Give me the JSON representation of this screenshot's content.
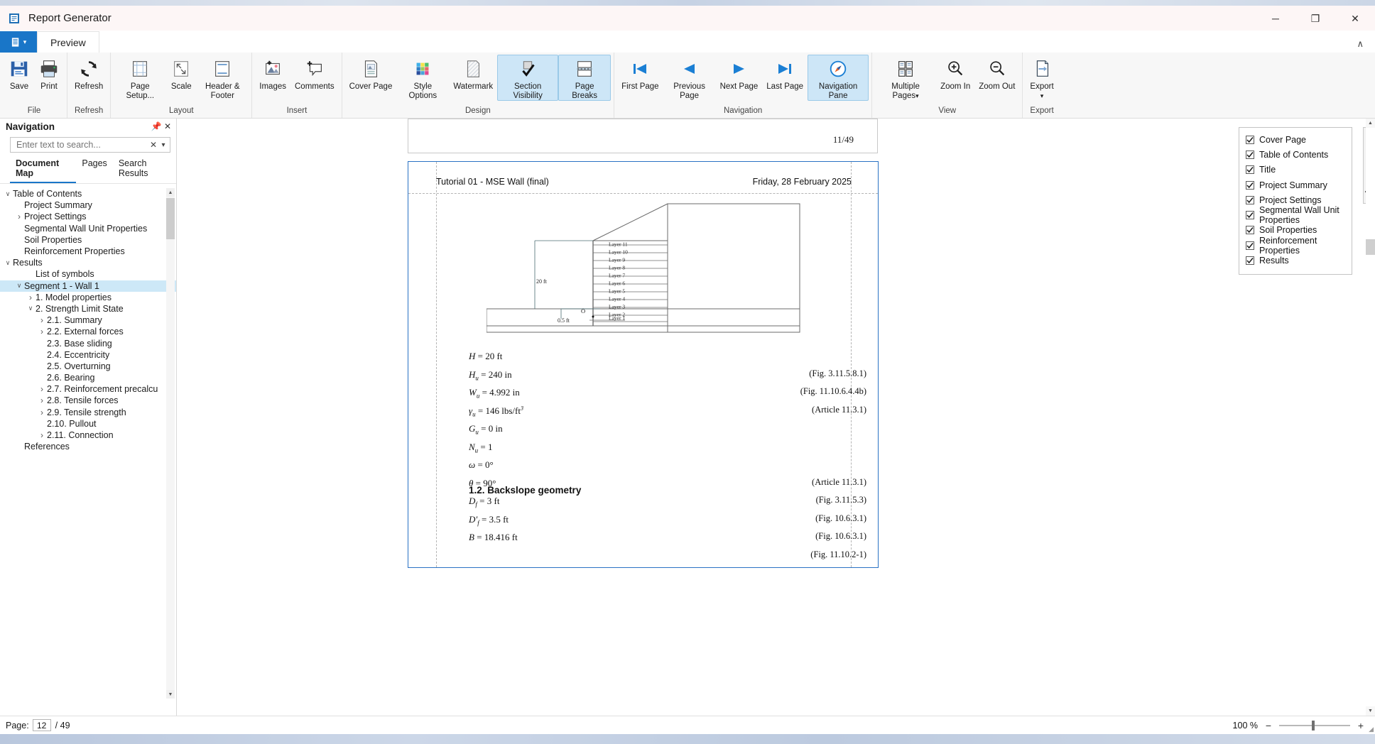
{
  "window": {
    "title": "Report Generator",
    "app_icon": "report-app-icon",
    "minimize": "─",
    "maximize": "❐",
    "close": "✕",
    "collapse_ribbon": "∧"
  },
  "ribbon": {
    "app_menu_label": "menu-icon",
    "tabs": [
      {
        "label": "Preview",
        "active": true
      }
    ],
    "groups": [
      {
        "name": "File",
        "label": "File",
        "items": [
          {
            "label": "Save",
            "icon": "save-icon",
            "selected": false
          },
          {
            "label": "Print",
            "icon": "print-icon",
            "selected": false
          }
        ]
      },
      {
        "name": "Refresh",
        "label": "Refresh",
        "items": [
          {
            "label": "Refresh",
            "icon": "refresh-icon",
            "selected": false
          }
        ]
      },
      {
        "name": "Layout",
        "label": "Layout",
        "items": [
          {
            "label": "Page Setup...",
            "icon": "page-setup-icon",
            "selected": false
          },
          {
            "label": "Scale",
            "icon": "scale-icon",
            "selected": false
          },
          {
            "label": "Header & Footer",
            "icon": "header-footer-icon",
            "selected": false
          }
        ]
      },
      {
        "name": "Insert",
        "label": "Insert",
        "items": [
          {
            "label": "Images",
            "icon": "images-icon",
            "selected": false
          },
          {
            "label": "Comments",
            "icon": "comments-icon",
            "selected": false
          }
        ]
      },
      {
        "name": "Design",
        "label": "Design",
        "items": [
          {
            "label": "Cover Page",
            "icon": "cover-page-icon",
            "selected": false
          },
          {
            "label": "Style Options",
            "icon": "style-options-icon",
            "selected": false
          },
          {
            "label": "Watermark",
            "icon": "watermark-icon",
            "selected": false
          },
          {
            "label": "Section Visibility",
            "icon": "section-visibility-icon",
            "selected": true
          },
          {
            "label": "Page Breaks",
            "icon": "page-breaks-icon",
            "selected": true
          }
        ]
      },
      {
        "name": "Navigation",
        "label": "Navigation",
        "items": [
          {
            "label": "First Page",
            "icon": "first-page-icon",
            "selected": false
          },
          {
            "label": "Previous Page",
            "icon": "previous-page-icon",
            "selected": false
          },
          {
            "label": "Next Page",
            "icon": "next-page-icon",
            "selected": false
          },
          {
            "label": "Last Page",
            "icon": "last-page-icon",
            "selected": false
          },
          {
            "label": "Navigation Pane",
            "icon": "navigation-pane-icon",
            "selected": true
          }
        ]
      },
      {
        "name": "View",
        "label": "View",
        "items": [
          {
            "label": "Multiple Pages",
            "icon": "multiple-pages-icon",
            "selected": false,
            "dropdown": true
          },
          {
            "label": "Zoom In",
            "icon": "zoom-in-icon",
            "selected": false
          },
          {
            "label": "Zoom Out",
            "icon": "zoom-out-icon",
            "selected": false
          }
        ]
      },
      {
        "name": "Export",
        "label": "Export",
        "items": [
          {
            "label": "Export",
            "icon": "export-icon",
            "selected": false,
            "dropdown": true
          }
        ]
      }
    ]
  },
  "navigation": {
    "title": "Navigation",
    "pin_icon": "pin-icon",
    "close_icon": "close-icon",
    "search": {
      "placeholder": "Enter text to search...",
      "value": "",
      "clear_icon": "clear-icon",
      "dropdown_icon": "chevron-down-icon"
    },
    "tabs": [
      {
        "label": "Document Map",
        "active": true
      },
      {
        "label": "Pages",
        "active": false
      },
      {
        "label": "Search Results",
        "active": false
      }
    ],
    "tree": [
      {
        "label": "Table of Contents",
        "indent": 1,
        "twisty": "down",
        "selected": false
      },
      {
        "label": "Project Summary",
        "indent": 2,
        "twisty": "none",
        "selected": false
      },
      {
        "label": "Project Settings",
        "indent": 2,
        "twisty": "right",
        "selected": false
      },
      {
        "label": "Segmental Wall Unit Properties",
        "indent": 2,
        "twisty": "none",
        "selected": false
      },
      {
        "label": "Soil Properties",
        "indent": 2,
        "twisty": "none",
        "selected": false
      },
      {
        "label": "Reinforcement Properties",
        "indent": 2,
        "twisty": "none",
        "selected": false
      },
      {
        "label": "Results",
        "indent": 1,
        "twisty": "down",
        "selected": false
      },
      {
        "label": "List of symbols",
        "indent": 3,
        "twisty": "none",
        "selected": false
      },
      {
        "label": "Segment 1 - Wall 1",
        "indent": 2,
        "twisty": "down",
        "selected": true
      },
      {
        "label": "1.  Model properties",
        "indent": 3,
        "twisty": "right",
        "selected": false
      },
      {
        "label": "2.  Strength Limit State",
        "indent": 3,
        "twisty": "down",
        "selected": false
      },
      {
        "label": "2.1.  Summary",
        "indent": 4,
        "twisty": "right",
        "selected": false
      },
      {
        "label": "2.2.  External forces",
        "indent": 4,
        "twisty": "right",
        "selected": false
      },
      {
        "label": "2.3.  Base sliding",
        "indent": 4,
        "twisty": "none",
        "selected": false
      },
      {
        "label": "2.4.  Eccentricity",
        "indent": 4,
        "twisty": "none",
        "selected": false
      },
      {
        "label": "2.5.  Overturning",
        "indent": 4,
        "twisty": "none",
        "selected": false
      },
      {
        "label": "2.6.  Bearing",
        "indent": 4,
        "twisty": "none",
        "selected": false
      },
      {
        "label": "2.7.  Reinforcement precalcu",
        "indent": 4,
        "twisty": "right",
        "selected": false
      },
      {
        "label": "2.8.  Tensile forces",
        "indent": 4,
        "twisty": "right",
        "selected": false
      },
      {
        "label": "2.9.  Tensile strength",
        "indent": 4,
        "twisty": "right",
        "selected": false
      },
      {
        "label": "2.10.  Pullout",
        "indent": 4,
        "twisty": "none",
        "selected": false
      },
      {
        "label": "2.11.  Connection",
        "indent": 4,
        "twisty": "right",
        "selected": false
      },
      {
        "label": "References",
        "indent": 2,
        "twisty": "none",
        "selected": false
      }
    ]
  },
  "preview": {
    "previous_page_number": "11/49",
    "header_left": "Tutorial 01 - MSE Wall (final)",
    "header_right": "Friday, 28 February 2025",
    "figure": {
      "height_label": "20 ft",
      "embed_label": "0.5 ft",
      "origin_label": "O",
      "layers": [
        "Layer 11",
        "Layer 10",
        "Layer 9",
        "Layer 8",
        "Layer 7",
        "Layer 6",
        "Layer 5",
        "Layer 4",
        "Layer 3",
        "Layer 2",
        "Layer 1"
      ]
    },
    "equations": [
      {
        "sym": "H",
        "sub": "",
        "eq": "= 20 ft",
        "sup": "",
        "ref": ""
      },
      {
        "sym": "H",
        "sub": "u",
        "eq": "= 240 in",
        "sup": "",
        "ref": "(Fig. 3.11.5.8.1)"
      },
      {
        "sym": "W",
        "sub": "u",
        "eq": "= 4.992 in",
        "sup": "",
        "ref": "(Fig. 11.10.6.4.4b)"
      },
      {
        "sym": "γ",
        "sub": "u",
        "eq": "= 146 lbs/ft",
        "sup": "3",
        "ref": "(Article 11.3.1)"
      },
      {
        "sym": "G",
        "sub": "u",
        "eq": "= 0 in",
        "sup": "",
        "ref": ""
      },
      {
        "sym": "N",
        "sub": "u",
        "eq": "= 1",
        "sup": "",
        "ref": ""
      },
      {
        "sym": "ω",
        "sub": "",
        "eq": "= 0°",
        "sup": "",
        "ref": ""
      },
      {
        "sym": "θ",
        "sub": "",
        "eq": "= 90°",
        "sup": "",
        "ref": "(Article 11.3.1)"
      },
      {
        "sym": "D",
        "sub": "f",
        "eq": "= 3 ft",
        "sup": "",
        "ref": "(Fig. 3.11.5.3)"
      },
      {
        "sym": "D′",
        "sub": "f",
        "eq": "= 3.5 ft",
        "sup": "",
        "ref": "(Fig. 10.6.3.1)"
      },
      {
        "sym": "B",
        "sub": "",
        "eq": "= 18.416 ft",
        "sup": "",
        "ref": "(Fig. 10.6.3.1)"
      },
      {
        "sym": "",
        "sub": "",
        "eq": "",
        "sup": "",
        "ref": "(Fig. 11.10.2-1)"
      }
    ],
    "section_heading": "1.2.  Backslope geometry"
  },
  "section_visibility": {
    "tab_label": "Section Visibility",
    "collapse_icon": "chevron-right-icon",
    "items": [
      {
        "label": "Cover Page",
        "checked": true
      },
      {
        "label": "Table of Contents",
        "checked": true
      },
      {
        "label": "Title",
        "checked": true
      },
      {
        "label": "Project Summary",
        "checked": true
      },
      {
        "label": "Project Settings",
        "checked": true
      },
      {
        "label": "Segmental Wall Unit Properties",
        "checked": true
      },
      {
        "label": "Soil Properties",
        "checked": true
      },
      {
        "label": "Reinforcement Properties",
        "checked": true
      },
      {
        "label": "Results",
        "checked": true
      }
    ]
  },
  "statusbar": {
    "page_label": "Page:",
    "page_value": "12",
    "page_total": "/ 49",
    "zoom_percent": "100 %",
    "zoom_out_icon": "minus-icon",
    "zoom_in_icon": "plus-icon"
  },
  "colors": {
    "accent": "#1976c8",
    "selection": "#cde8f7",
    "ribbon_bg": "#f7f7f7",
    "page_border_active": "#2a72c4"
  }
}
